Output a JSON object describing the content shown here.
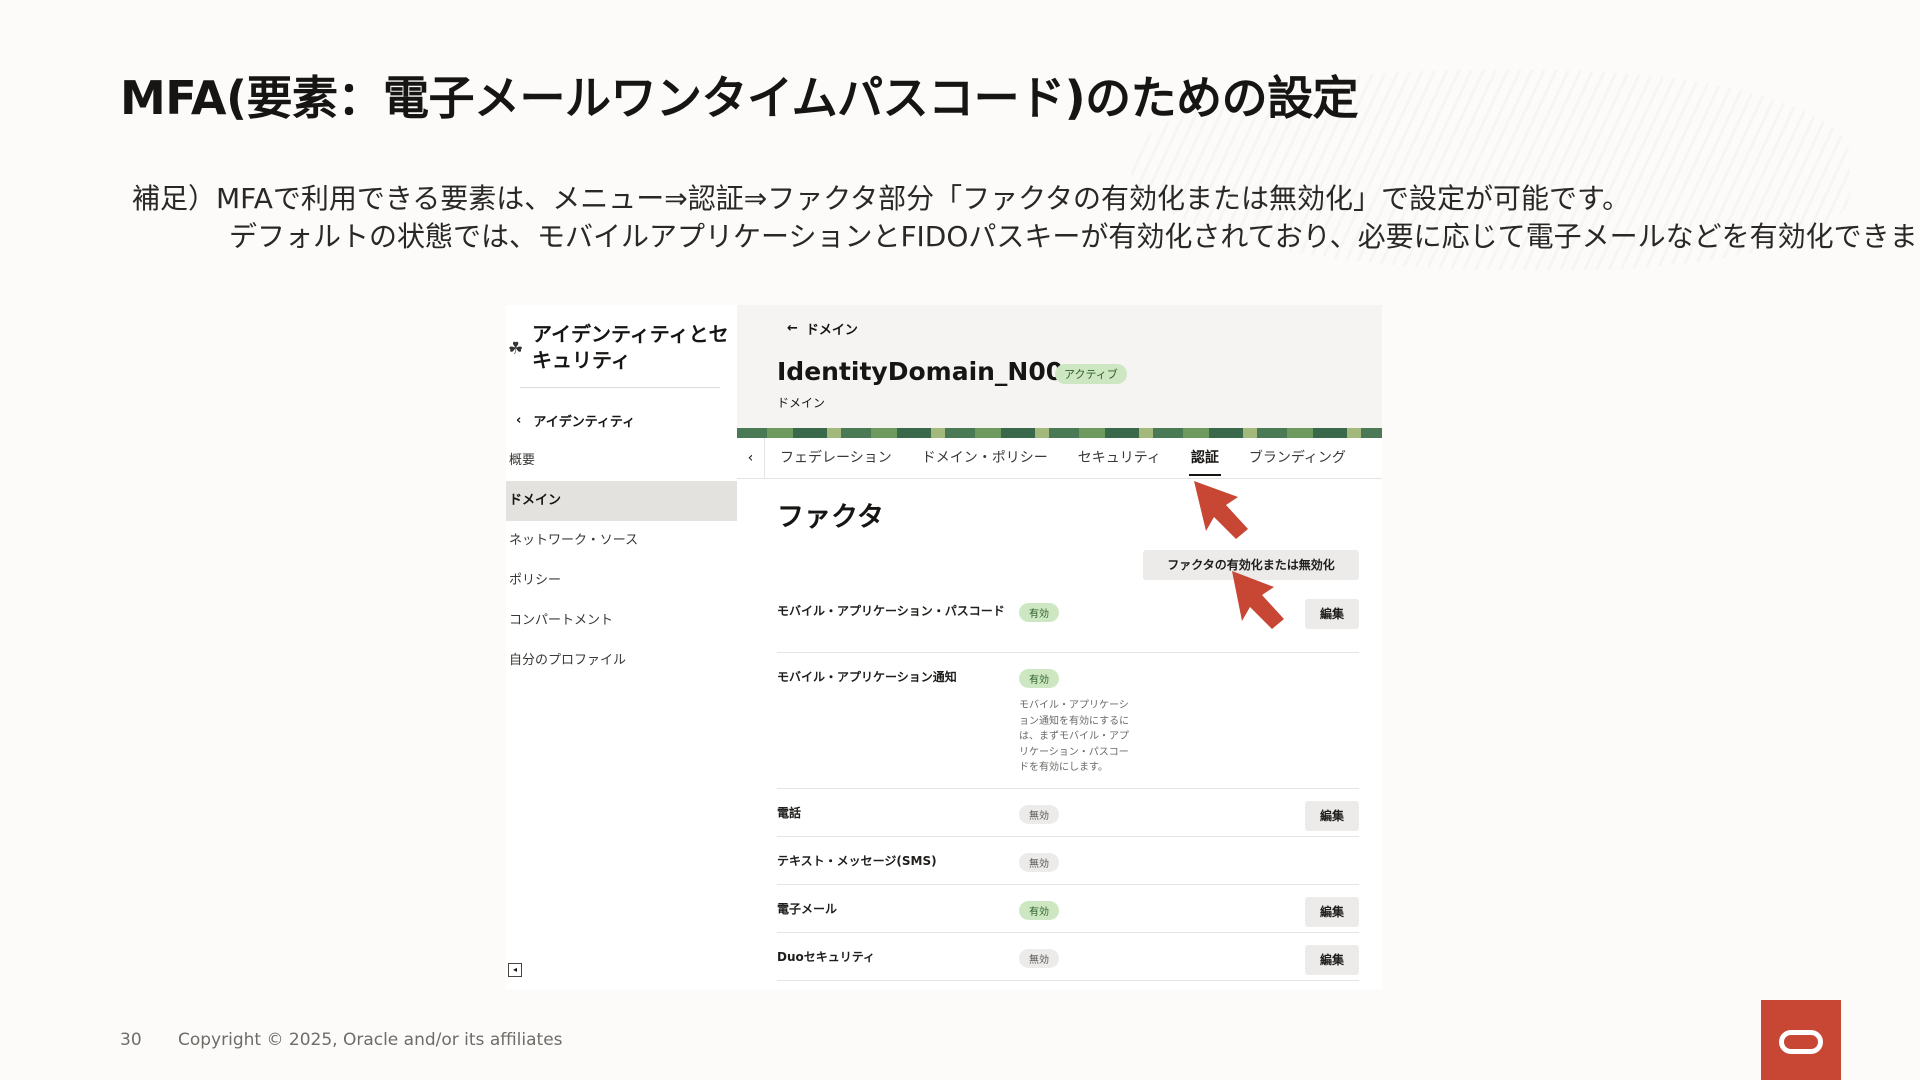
{
  "slide": {
    "title": "MFA(要素：電子メールワンタイムパスコード)のための設定",
    "note_line1": "補足）MFAで利用できる要素は、メニュー⇒認証⇒ファクタ部分「ファクタの有効化または無効化」で設定が可能です。",
    "note_line2": "デフォルトの状態では、モバイルアプリケーションとFIDOパスキーが有効化されており、必要に応じて電子メールなどを有効化できます。",
    "page_number": "30",
    "copyright": "Copyright © 2025, Oracle and/or its affiliates"
  },
  "sidebar": {
    "title": "アイデンティティとセキュリティ",
    "back_label": "アイデンティティ",
    "items": [
      {
        "label": "概要"
      },
      {
        "label": "ドメイン"
      },
      {
        "label": "ネットワーク・ソース"
      },
      {
        "label": "ポリシー"
      },
      {
        "label": "コンパートメント"
      },
      {
        "label": "自分のプロファイル"
      }
    ],
    "active_index": 1
  },
  "header": {
    "back_label": "ドメイン",
    "domain_name": "IdentityDomain_N00",
    "state": "アクティブ",
    "subtitle": "ドメイン"
  },
  "tabs": [
    {
      "label": "フェデレーション"
    },
    {
      "label": "ドメイン・ポリシー"
    },
    {
      "label": "セキュリティ"
    },
    {
      "label": "認証"
    },
    {
      "label": "ブランディング"
    }
  ],
  "factors": {
    "title": "ファクタ",
    "toggle_button": "ファクタの有効化または無効化",
    "edit_label": "編集",
    "rows": [
      {
        "name": "モバイル・アプリケーション・パスコード",
        "status": "有効",
        "enabled": true,
        "editable": true,
        "desc": ""
      },
      {
        "name": "モバイル・アプリケーション通知",
        "status": "有効",
        "enabled": true,
        "editable": false,
        "desc": "モバイル・アプリケーション通知を有効にするには、まずモバイル・アプリケーション・パスコードを有効にします。"
      },
      {
        "name": "電話",
        "status": "無効",
        "enabled": false,
        "editable": true,
        "desc": ""
      },
      {
        "name": "テキスト・メッセージ(SMS)",
        "status": "無効",
        "enabled": false,
        "editable": false,
        "desc": ""
      },
      {
        "name": "電子メール",
        "status": "有効",
        "enabled": true,
        "editable": true,
        "desc": ""
      },
      {
        "name": "Duoセキュリティ",
        "status": "無効",
        "enabled": false,
        "editable": true,
        "desc": ""
      }
    ]
  },
  "colors": {
    "accent_red": "#c74634",
    "badge_on": "#cde7c3",
    "badge_off": "#ecebe9"
  }
}
